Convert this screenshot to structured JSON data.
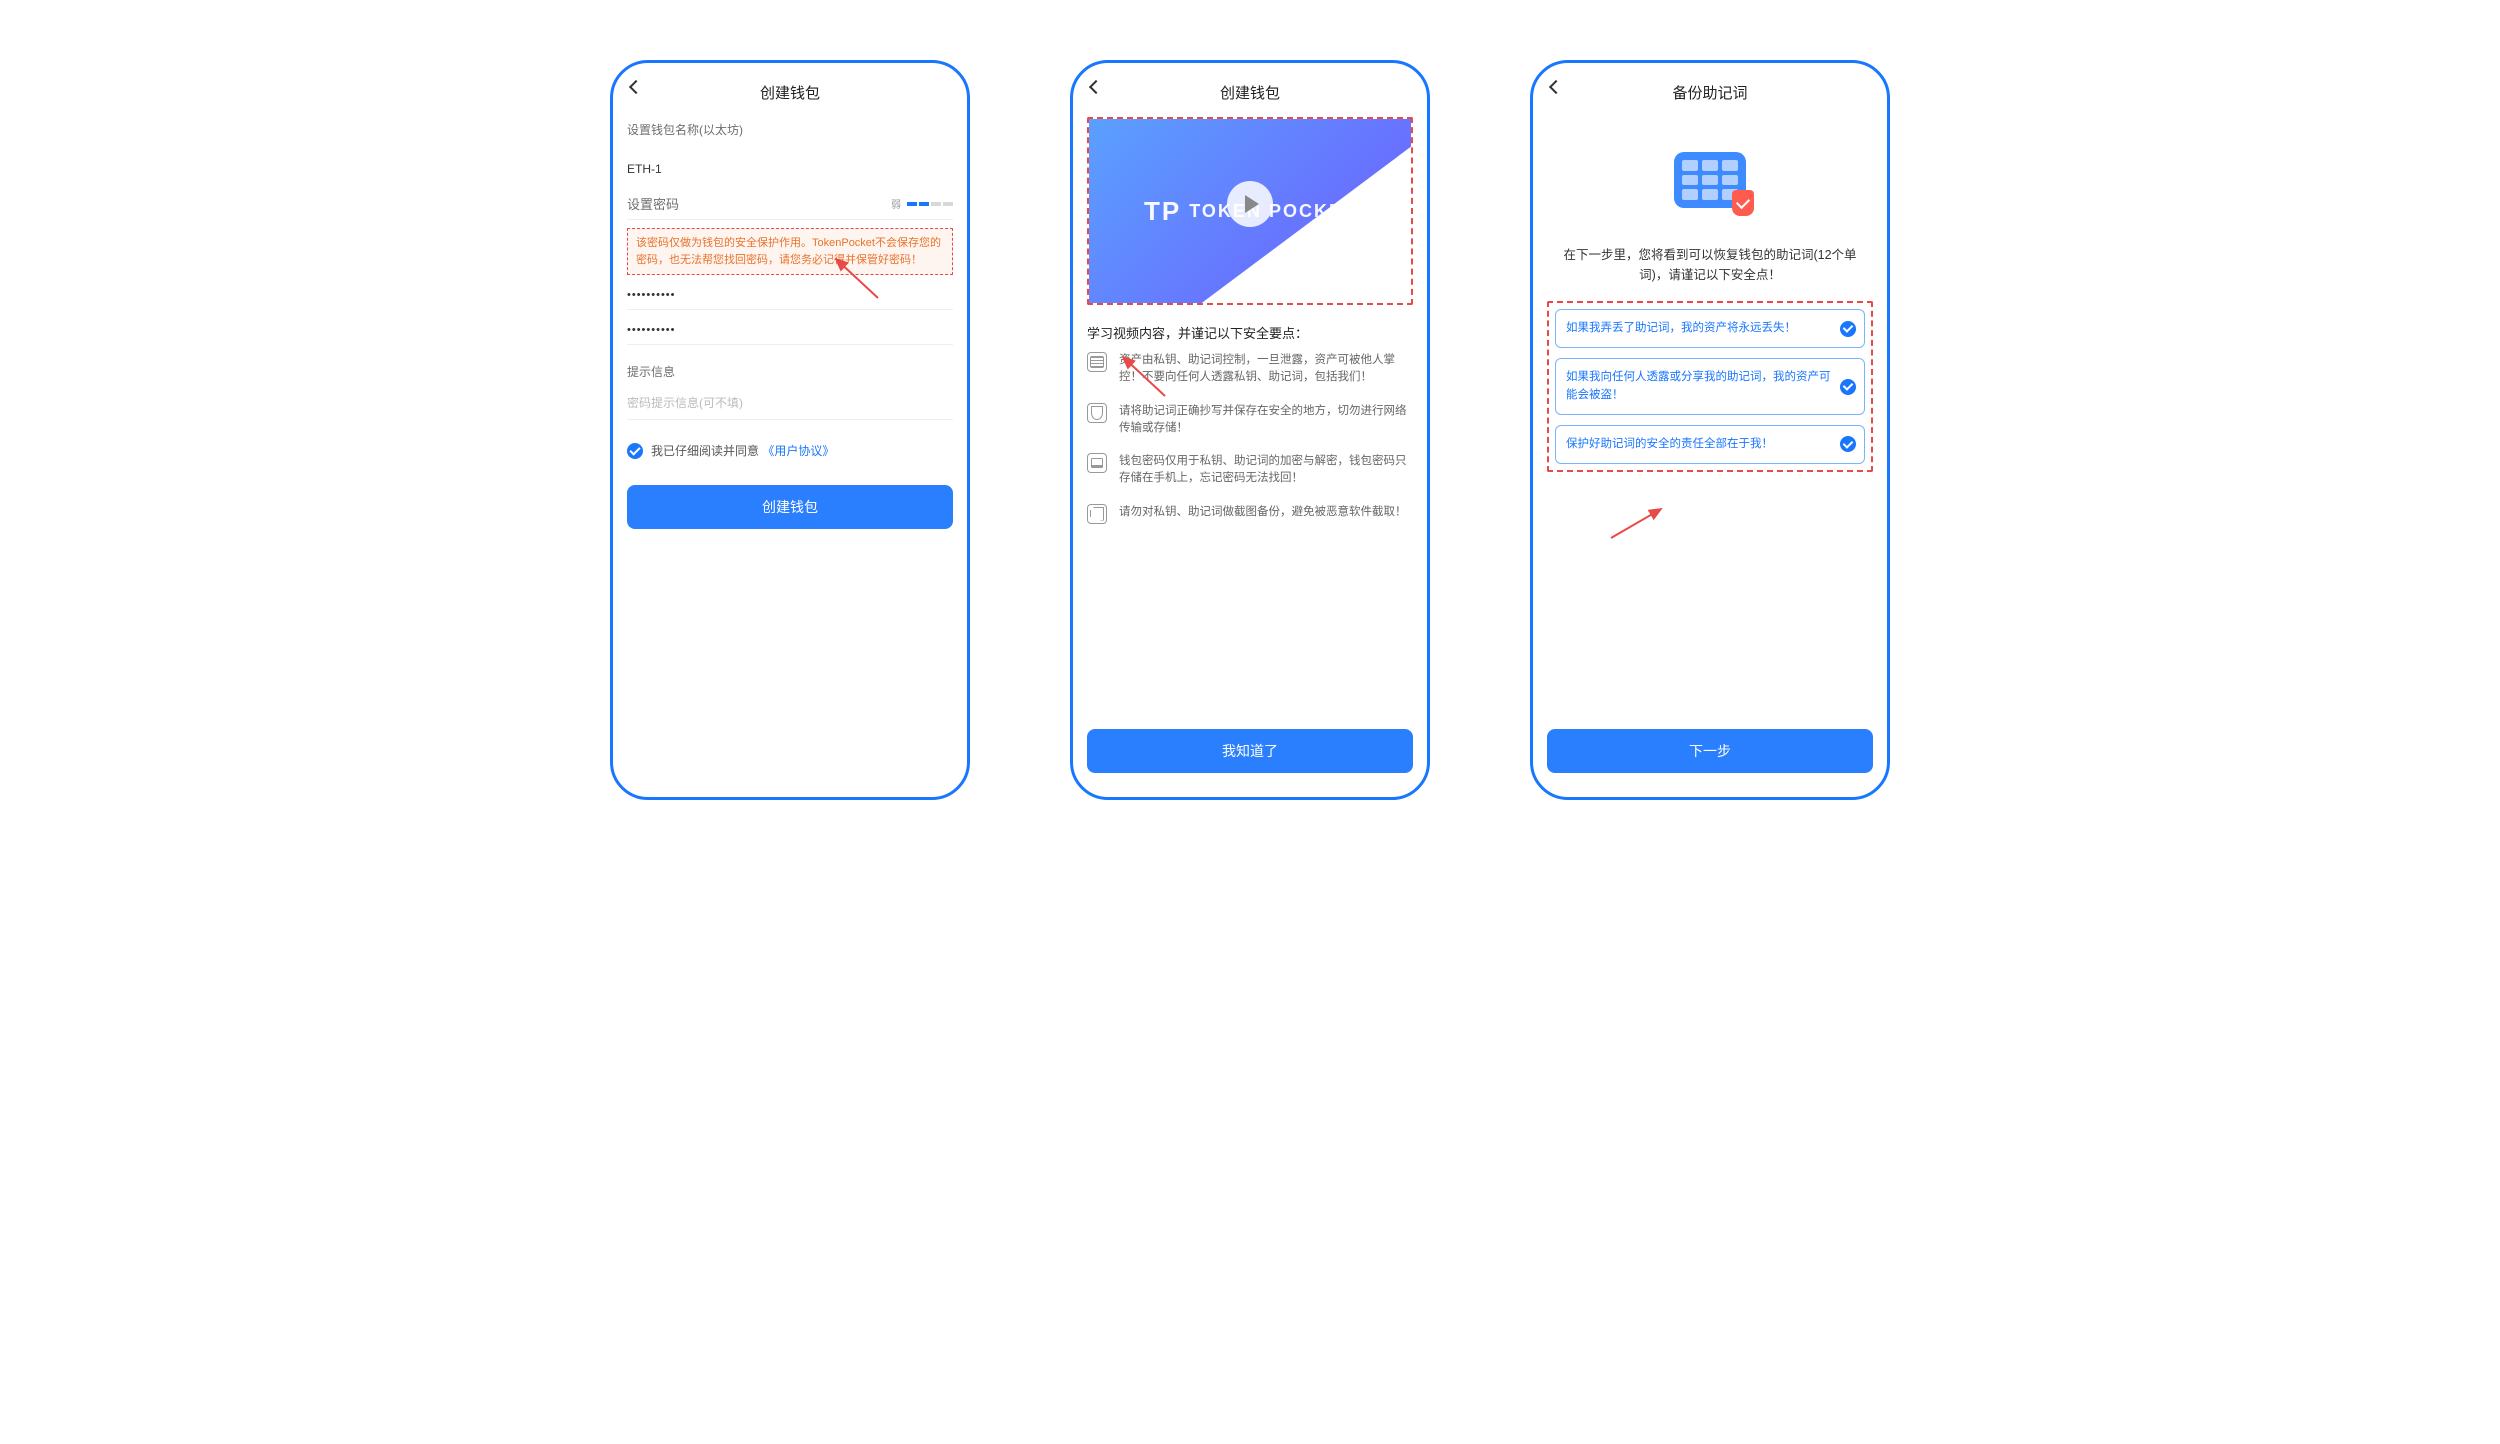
{
  "screen1": {
    "title": "创建钱包",
    "name_label": "设置钱包名称(以太坊)",
    "name_value": "ETH-1",
    "pwd_label": "设置密码",
    "pwd_strength_prefix": "弱",
    "warning": "该密码仅做为钱包的安全保护作用。TokenPocket不会保存您的密码，也无法帮您找回密码，请您务必记得并保管好密码！",
    "pwd_value": "••••••••••",
    "pwd_confirm": "••••••••••",
    "hint_label": "提示信息",
    "hint_placeholder": "密码提示信息(可不填)",
    "agree_pre": "我已仔细阅读并同意",
    "agree_link": "《用户协议》",
    "submit": "创建钱包"
  },
  "screen2": {
    "title": "创建钱包",
    "brand_tp": "TP",
    "brand_text": "TOKEN POCKET",
    "tips_head": "学习视频内容，并谨记以下安全要点：",
    "tips": [
      "资产由私钥、助记词控制，一旦泄露，资产可被他人掌控！不要向任何人透露私钥、助记词，包括我们！",
      "请将助记词正确抄写并保存在安全的地方，切勿进行网络传输或存储！",
      "钱包密码仅用于私钥、助记词的加密与解密，钱包密码只存储在手机上，忘记密码无法找回！",
      "请勿对私钥、助记词做截图备份，避免被恶意软件截取！"
    ],
    "ok": "我知道了"
  },
  "screen3": {
    "title": "备份助记词",
    "desc": "在下一步里，您将看到可以恢复钱包的助记词(12个单词)，请谨记以下安全点！",
    "acks": [
      "如果我弄丢了助记词，我的资产将永远丢失！",
      "如果我向任何人透露或分享我的助记词，我的资产可能会被盗！",
      "保护好助记词的安全的责任全部在于我！"
    ],
    "next": "下一步"
  }
}
